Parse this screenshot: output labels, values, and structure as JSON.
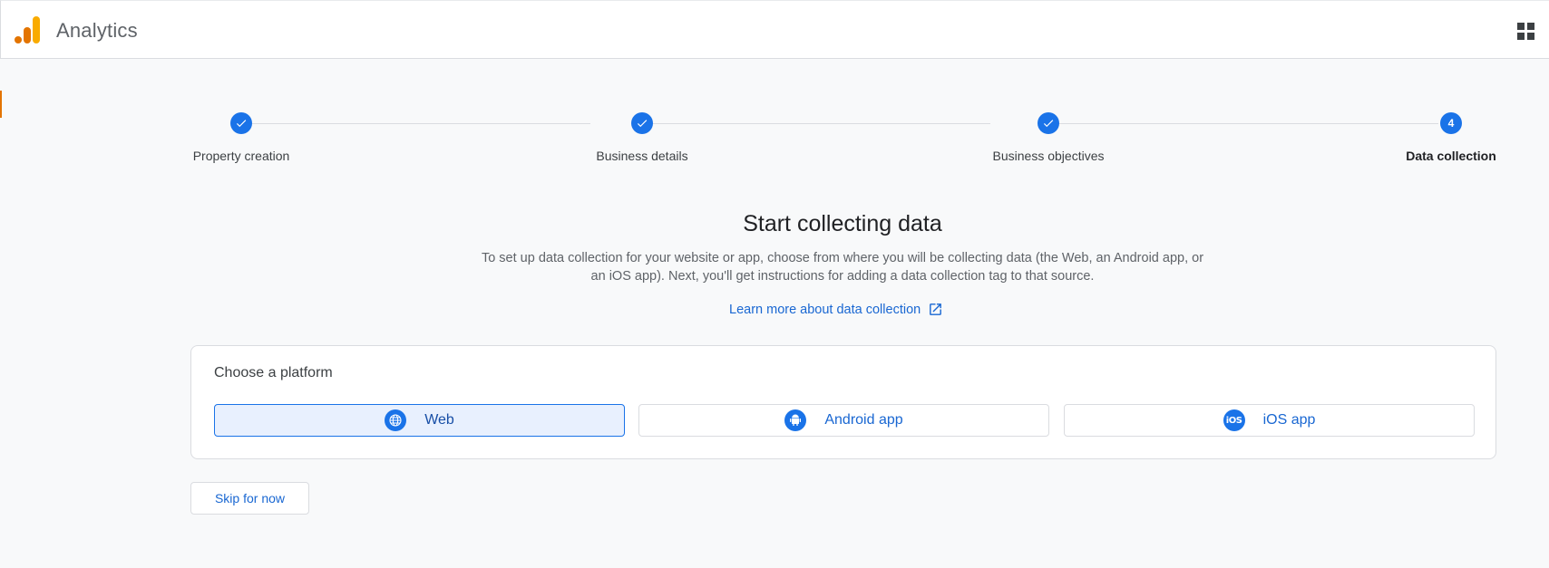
{
  "header": {
    "app_title": "Analytics",
    "apps_icon": "apps-grid-icon"
  },
  "stepper": {
    "steps": [
      {
        "label": "Property creation",
        "state": "complete"
      },
      {
        "label": "Business details",
        "state": "complete"
      },
      {
        "label": "Business objectives",
        "state": "complete"
      },
      {
        "label": "Data collection",
        "state": "current",
        "number": "4"
      }
    ]
  },
  "main": {
    "title": "Start collecting data",
    "description": "To set up data collection for your website or app, choose from where you will be collecting data (the Web, an Android app, or an iOS app). Next, you'll get instructions for adding a data collection tag to that source.",
    "learn_more": "Learn more about data collection"
  },
  "platform": {
    "title": "Choose a platform",
    "options": [
      {
        "label": "Web",
        "icon": "globe-icon",
        "selected": true
      },
      {
        "label": "Android app",
        "icon": "android-icon",
        "selected": false
      },
      {
        "label": "iOS app",
        "icon": "ios-icon",
        "icon_text": "iOS",
        "selected": false
      }
    ]
  },
  "actions": {
    "skip_label": "Skip for now"
  },
  "colors": {
    "primary": "#1a73e8",
    "link": "#1967d2",
    "logo_orange": "#e37400",
    "logo_yellow": "#f9ab00",
    "selected_bg": "#e8f0fe"
  }
}
